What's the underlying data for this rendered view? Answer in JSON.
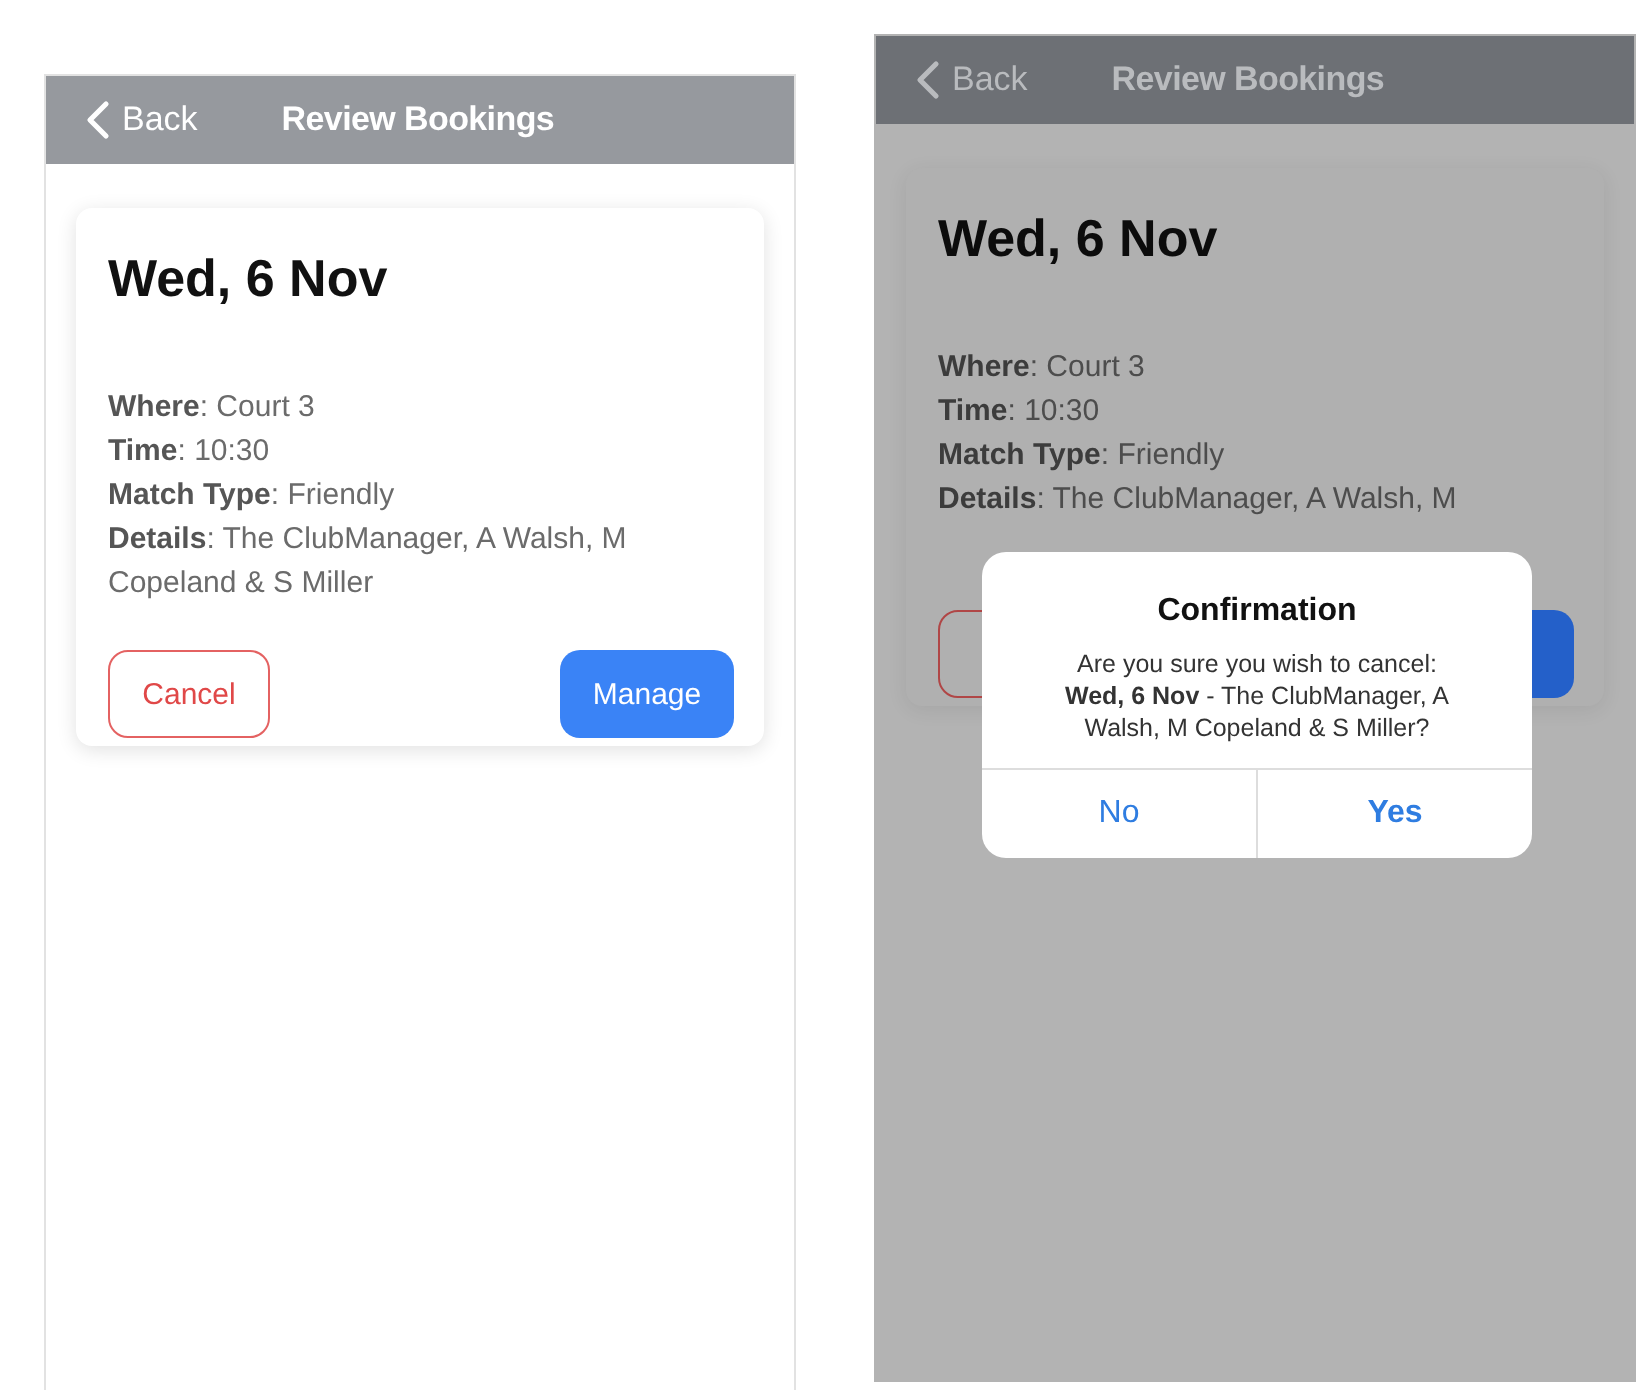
{
  "screens": [
    {
      "dimmed": false,
      "header": {
        "back": "Back",
        "title": "Review Bookings"
      },
      "card": {
        "date": "Wed, 6 Nov",
        "fields": [
          "**Where**: Court 3",
          "**Time**: 10:30",
          "**Match Type**: Friendly",
          "**Details**: The ClubManager, A Walsh, M Copeland & S Miller"
        ],
        "buttons": [
          {
            "kind": "outline",
            "label": "Cancel"
          },
          {
            "kind": "filled",
            "label": "Manage"
          }
        ]
      }
    },
    {
      "dimmed": true,
      "header": {
        "back": "Back",
        "title": "Review Bookings"
      },
      "card": {
        "date": "Wed, 6 Nov",
        "fields": [
          "**Where**: Court 3",
          "**Time**: 10:30",
          "**Match Type**: Friendly",
          "**Details**: The ClubManager, A Walsh, M"
        ],
        "buttons": [
          {
            "kind": "outline"
          },
          {
            "kind": "filled"
          }
        ]
      },
      "dialog": {
        "title": "Confirmation",
        "message": "Are you sure you wish to cancel: **Wed, 6 Nov** - The ClubManager, A Walsh, M Copeland & S Miller?",
        "buttons": [
          {
            "label": "No",
            "primary": false
          },
          {
            "label": "Yes",
            "primary": true
          }
        ]
      }
    }
  ]
}
